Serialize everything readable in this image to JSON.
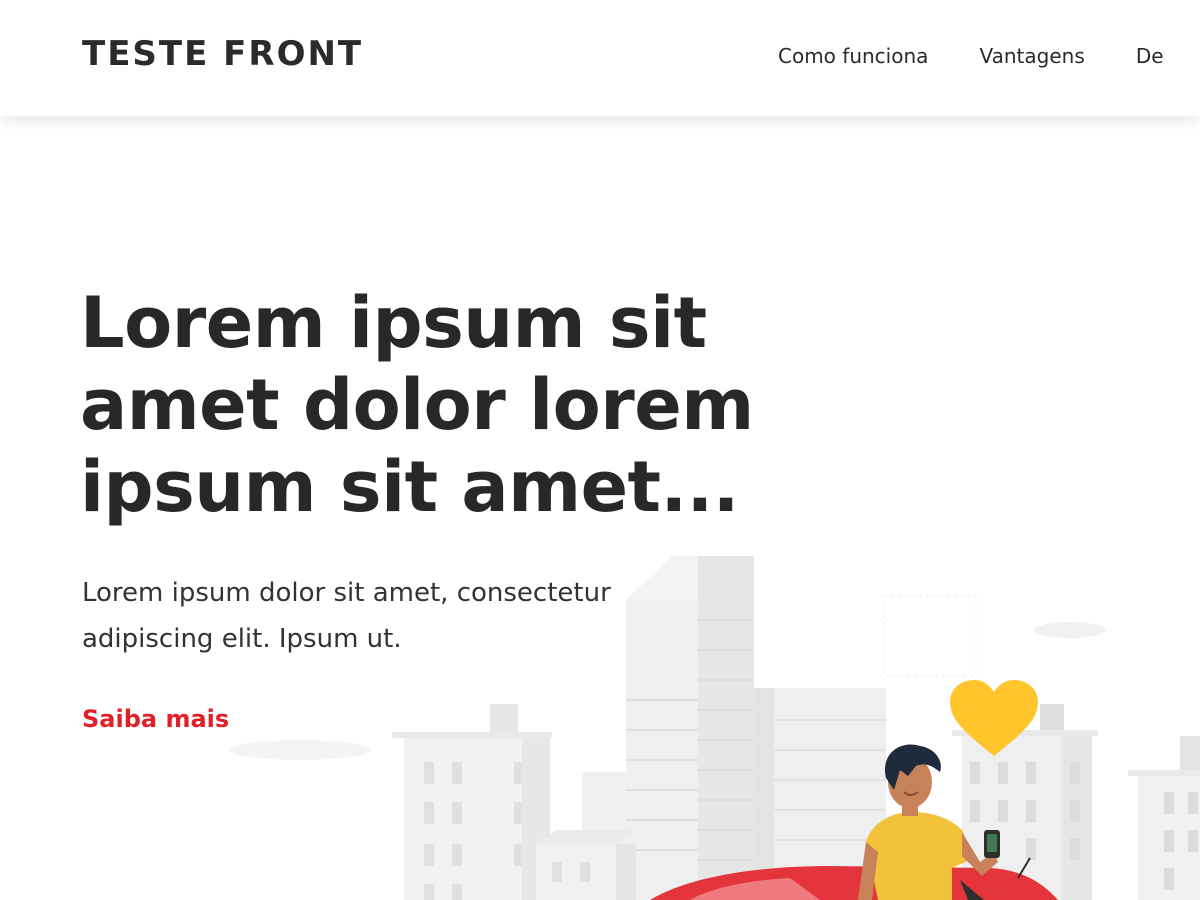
{
  "header": {
    "logo": "TESTE FRONT",
    "nav": [
      {
        "label": "Como funciona"
      },
      {
        "label": "Vantagens"
      },
      {
        "label": "De"
      }
    ]
  },
  "hero": {
    "title": "Lorem ipsum sit amet dolor lorem ipsum sit amet...",
    "subtitle": "Lorem ipsum dolor sit amet, consectetur adipiscing elit. Ipsum ut.",
    "cta": "Saiba mais"
  },
  "colors": {
    "accent": "#e01f26",
    "text": "#282828",
    "heart": "#ffc52b",
    "shirt": "#f2c23a",
    "car": "#e3333b",
    "buildings": "#ececec"
  }
}
